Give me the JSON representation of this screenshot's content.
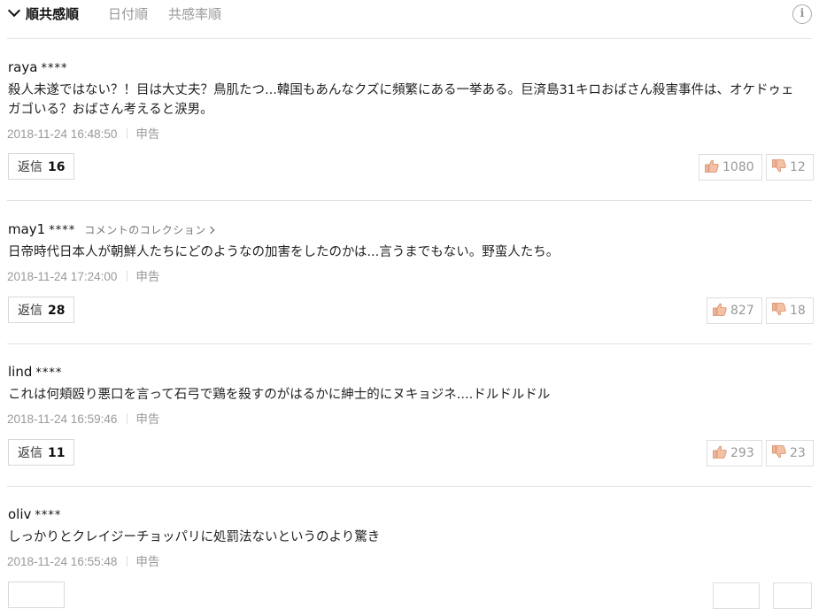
{
  "sort": {
    "active": "順共感順",
    "date": "日付順",
    "rate": "共感率順",
    "info": "i"
  },
  "comments": [
    {
      "author": "raya",
      "stars": "****",
      "collection": "",
      "text": "殺人未遂ではない？！目は大丈夫？鳥肌たつ...韓国もあんなクズに頻繁にある一挙ある。巨済島31キロおばさん殺害事件は、オケドゥェガゴいる？おばさん考えると涙男。",
      "date": "2018-11-24 16:48:50",
      "report": "申告",
      "reply_label": "返信",
      "reply_count": "16",
      "likes": "1080",
      "dislikes": "12"
    },
    {
      "author": "may1",
      "stars": "****",
      "collection": "コメントのコレクション",
      "text": "日帝時代日本人が朝鮮人たちにどのようなの加害をしたのかは...言うまでもない。野蛮人たち。",
      "date": "2018-11-24 17:24:00",
      "report": "申告",
      "reply_label": "返信",
      "reply_count": "28",
      "likes": "827",
      "dislikes": "18"
    },
    {
      "author": "lind",
      "stars": "****",
      "collection": "",
      "text": "これは何頬殴り悪口を言って石弓で鶏を殺すのがはるかに紳士的にヌキョジネ....ドルドルドル",
      "date": "2018-11-24 16:59:46",
      "report": "申告",
      "reply_label": "返信",
      "reply_count": "11",
      "likes": "293",
      "dislikes": "23"
    },
    {
      "author": "oliv",
      "stars": "****",
      "collection": "",
      "text": "しっかりとクレイジーチョッパリに処罰法ないというのより驚き",
      "date": "2018-11-24 16:55:48",
      "report": "申告",
      "reply_label": "返信",
      "reply_count": "",
      "likes": "",
      "dislikes": ""
    }
  ],
  "icons": {
    "like": "thumbs-up-icon",
    "dislike": "thumbs-down-icon",
    "info": "info-icon",
    "sort_chevron": "chevron-down-icon"
  },
  "colors": {
    "like_icon": "#e8a07e",
    "dislike_icon": "#e8a07e",
    "muted_text": "#999999"
  }
}
